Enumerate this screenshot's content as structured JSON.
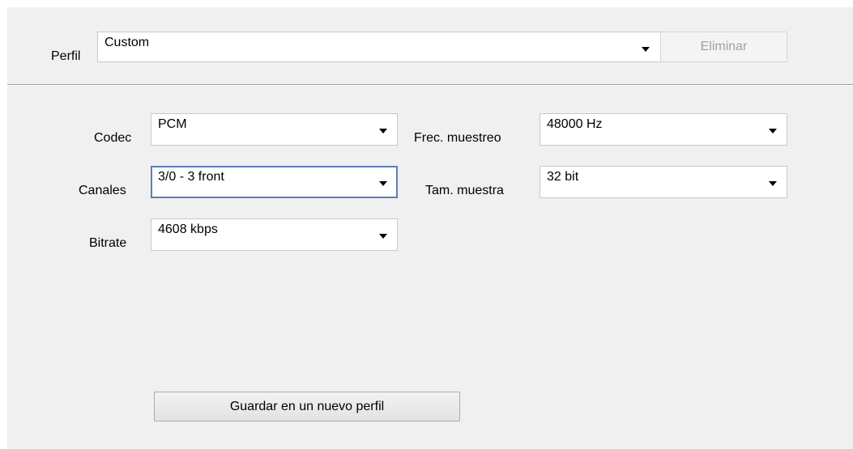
{
  "profile": {
    "label": "Perfil",
    "value": "Custom",
    "delete_label": "Eliminar"
  },
  "audio": {
    "codec": {
      "label": "Codec",
      "value": "PCM"
    },
    "channels": {
      "label": "Canales",
      "value": "3/0 - 3 front"
    },
    "bitrate": {
      "label": "Bitrate",
      "value": "4608 kbps"
    },
    "sample_rate": {
      "label": "Frec. muestreo",
      "value": "48000 Hz"
    },
    "sample_size": {
      "label": "Tam. muestra",
      "value": "32 bit"
    }
  },
  "actions": {
    "save_new_label": "Guardar en un nuevo perfil"
  },
  "icons": {
    "dropdown": "chevron-down-icon"
  }
}
